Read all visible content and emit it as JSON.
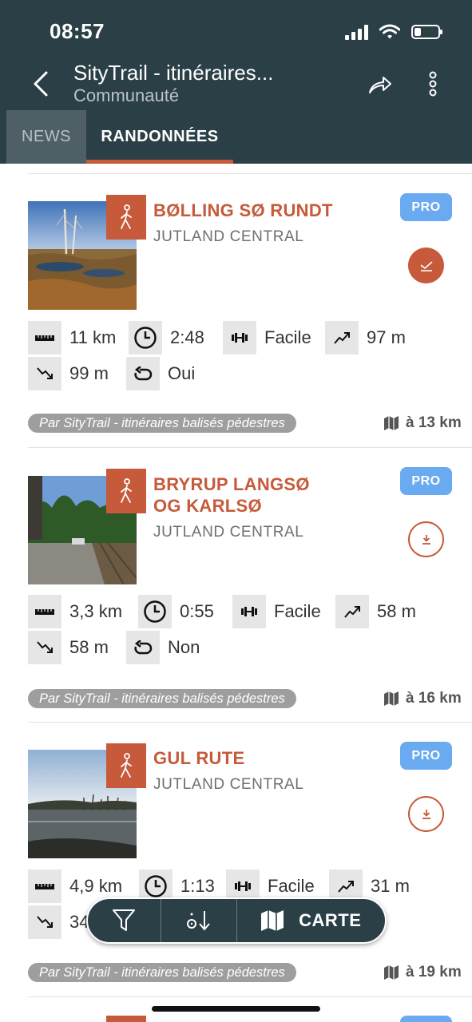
{
  "status_bar": {
    "time": "08:57",
    "battery_percent": 30
  },
  "header": {
    "title": "SityTrail - itinéraires...",
    "subtitle": "Communauté"
  },
  "tabs": [
    {
      "label": "NEWS",
      "active": false
    },
    {
      "label": "RANDONNÉES",
      "active": true
    }
  ],
  "colors": {
    "header_bg": "#2b3f47",
    "accent": "#c65a3a",
    "pro_badge": "#6aaaf0"
  },
  "trails": [
    {
      "title": "BØLLING SØ RUNDT",
      "region": "JUTLAND CENTRAL",
      "badge": "PRO",
      "action": "completed",
      "distance": "11 km",
      "duration": "2:48",
      "difficulty": "Facile",
      "elevation_gain": "97 m",
      "elevation_loss": "99 m",
      "loop": "Oui",
      "author": "Par SityTrail - itinéraires balisés pédestres",
      "distance_away": "à 13 km"
    },
    {
      "title": "BRYRUP LANGSØ OG KARLSØ",
      "region": "JUTLAND CENTRAL",
      "badge": "PRO",
      "action": "download",
      "distance": "3,3 km",
      "duration": "0:55",
      "difficulty": "Facile",
      "elevation_gain": "58 m",
      "elevation_loss": "58 m",
      "loop": "Non",
      "author": "Par SityTrail - itinéraires balisés pédestres",
      "distance_away": "à 16 km"
    },
    {
      "title": "GUL RUTE",
      "region": "JUTLAND CENTRAL",
      "badge": "PRO",
      "action": "download",
      "distance": "4,9 km",
      "duration": "1:13",
      "difficulty": "Facile",
      "elevation_gain": "31 m",
      "elevation_loss": "34",
      "author": "Par SityTrail - itinéraires balisés pédestres",
      "distance_away": "à 19 km"
    }
  ],
  "bottom_bar": {
    "map_label": "CARTE",
    "icons": [
      "filter-icon",
      "sort-icon",
      "map-icon"
    ]
  }
}
